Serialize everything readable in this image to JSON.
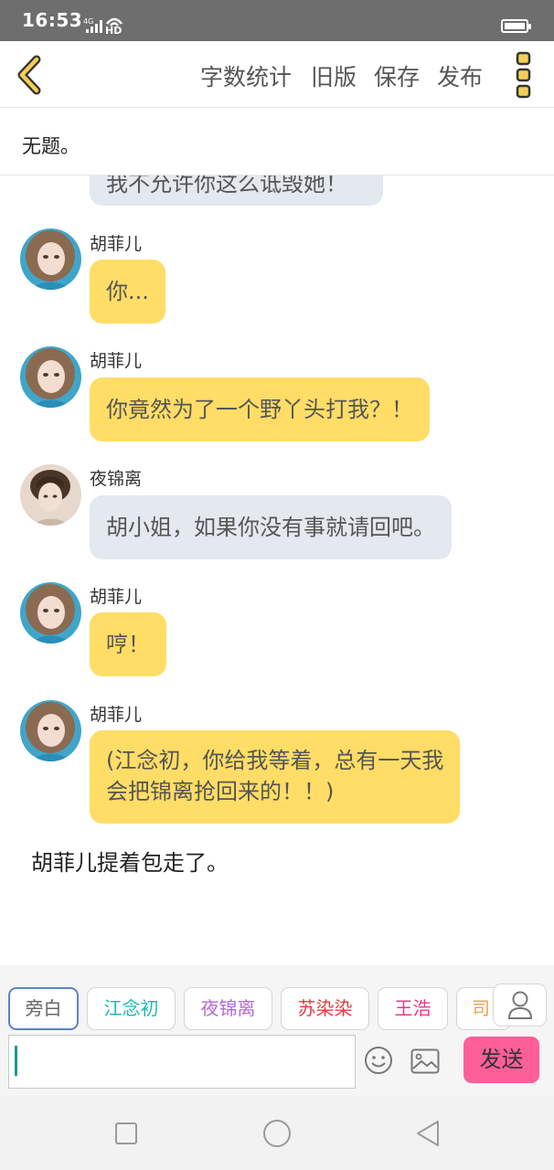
{
  "status_bar": {
    "time": "16:53",
    "network": "4G",
    "hd": "HD"
  },
  "toolbar": {
    "word_count": "字数统计",
    "old_version": "旧版",
    "save": "保存",
    "publish": "发布"
  },
  "title": "无题。",
  "messages": [
    {
      "sender": "",
      "text": "我不允许你这么诋毁她！",
      "color": "grey",
      "partial": true
    },
    {
      "sender": "胡菲儿",
      "text": "你...",
      "color": "yellow"
    },
    {
      "sender": "胡菲儿",
      "text": "你竟然为了一个野丫头打我？！",
      "color": "yellow"
    },
    {
      "sender": "夜锦离",
      "text": "胡小姐，如果你没有事就请回吧。",
      "color": "grey"
    },
    {
      "sender": "胡菲儿",
      "text": "哼！",
      "color": "yellow"
    },
    {
      "sender": "胡菲儿",
      "text_line1": "(江念初，你给我等着，总有一天我",
      "text_line2": "会把锦离抢回来的！！)",
      "color": "yellow"
    }
  ],
  "narration": "胡菲儿提着包走了。",
  "role_chips": [
    {
      "label": "旁白",
      "color": "#666666",
      "selected": true
    },
    {
      "label": "江念初",
      "color": "#1fb8b3"
    },
    {
      "label": "夜锦离",
      "color": "#b36ad9"
    },
    {
      "label": "苏染染",
      "color": "#e03c3c"
    },
    {
      "label": "王浩",
      "color": "#e03c8a"
    },
    {
      "label": "司",
      "color": "#f0a050"
    }
  ],
  "input": {
    "value": "",
    "placeholder": ""
  },
  "send_label": "发送",
  "colors": {
    "bubble_yellow": "#ffdd66",
    "bubble_grey": "#e4e8ef",
    "send": "#ff5f99",
    "accent": "#d4b84a"
  }
}
